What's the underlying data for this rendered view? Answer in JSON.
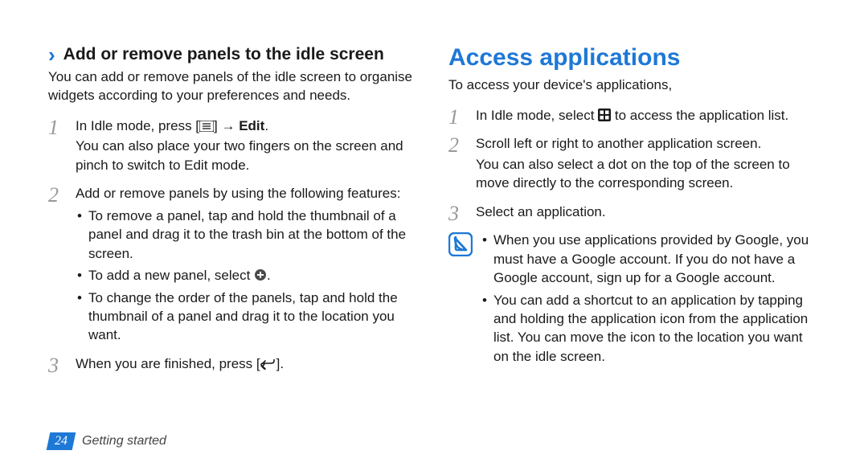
{
  "left": {
    "heading": "Add or remove panels to the idle screen",
    "intro": "You can add or remove panels of the idle screen to organise widgets according to your preferences and needs.",
    "steps": [
      {
        "text_before": "In Idle mode, press [",
        "icon": "menu-icon",
        "text_after": "] → ",
        "bold": "Edit",
        "period": ".",
        "extra": "You can also place your two fingers on the screen and pinch to switch to Edit mode."
      },
      {
        "text": "Add or remove panels by using the following features:",
        "bullets": [
          "To remove a panel, tap and hold the thumbnail of a panel and drag it to the trash bin at the bottom of the screen.",
          {
            "before": "To add a new panel, select ",
            "icon": "add-circle-icon",
            "after": "."
          },
          "To change the order of the panels, tap and hold the thumbnail of a panel and drag it to the location you want."
        ]
      },
      {
        "text_before": "When you are finished, press [",
        "icon": "back-icon",
        "text_after": "]."
      }
    ]
  },
  "right": {
    "heading": "Access applications",
    "intro": "To access your device's applications,",
    "steps": [
      {
        "text_before": "In Idle mode, select ",
        "icon": "apps-icon",
        "text_after": " to access the application list."
      },
      {
        "text": "Scroll left or right to another application screen.",
        "extra": "You can also select a dot on the top of the screen to move directly to the corresponding screen."
      },
      {
        "text": "Select an application."
      }
    ],
    "note_bullets": [
      "When you use applications provided by Google, you must have a Google account. If you do not have a Google account, sign up for a Google account.",
      "You can add a shortcut to an application by tapping and holding the application icon from the application list. You can move the icon to the location you want on the idle screen."
    ]
  },
  "footer": {
    "page": "24",
    "section": "Getting started"
  }
}
